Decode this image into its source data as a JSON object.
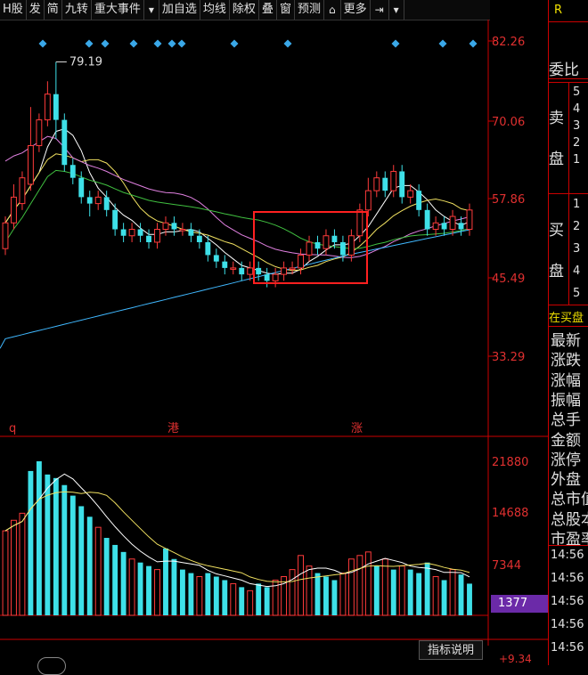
{
  "toolbar": {
    "items": [
      "H股",
      "发",
      "简",
      "九转",
      "重大事件",
      "▾",
      "加自选",
      "均线",
      "除权",
      "叠",
      "窗",
      "预测",
      "⌂",
      "更多",
      "⇥",
      "▾"
    ]
  },
  "price_axis": [
    "82.26",
    "70.06",
    "57.86",
    "45.49",
    "33.29"
  ],
  "volume_axis": [
    "21880",
    "14688",
    "7344"
  ],
  "volume_current": "1377",
  "max_label": "79.19",
  "event_markers": [
    "q",
    "港",
    "涨"
  ],
  "indicator_button": "指标说明",
  "bottom_pct": "+9.34",
  "right_panel": {
    "top_letter": "R",
    "weibi": "委比",
    "sell_label_1": "卖",
    "sell_label_2": "盘",
    "buy_label_1": "买",
    "buy_label_2": "盘",
    "sell_nums": [
      "5",
      "4",
      "3",
      "2",
      "1"
    ],
    "buy_nums": [
      "1",
      "2",
      "3",
      "4",
      "5"
    ],
    "zaimai": "在买盘",
    "fields": [
      "最新",
      "涨跌",
      "涨幅",
      "振幅",
      "总手",
      "金额",
      "涨停",
      "外盘",
      "总市值",
      "总股本",
      "市盈率"
    ],
    "times": [
      "14:56",
      "14:56",
      "14:56",
      "14:56",
      "14:56"
    ]
  },
  "colors": {
    "up": "#ff3b3b",
    "down": "#3ee0e8",
    "ma1": "#ffffff",
    "ma2": "#f0e060",
    "ma3": "#e080e0",
    "ma4": "#40c040",
    "ma5": "#40b8ff",
    "diamond": "#3aa8e8",
    "highlight": "#ff2020"
  },
  "chart_data": {
    "type": "candlestick",
    "ylim": [
      33.29,
      82.26
    ],
    "candles": [
      {
        "o": 50,
        "c": 54,
        "h": 55,
        "l": 49
      },
      {
        "o": 54,
        "c": 58,
        "h": 60,
        "l": 53
      },
      {
        "o": 57,
        "c": 61,
        "h": 62,
        "l": 56
      },
      {
        "o": 60,
        "c": 66,
        "h": 72,
        "l": 59
      },
      {
        "o": 66,
        "c": 70,
        "h": 71,
        "l": 65
      },
      {
        "o": 70,
        "c": 74,
        "h": 76,
        "l": 69
      },
      {
        "o": 74,
        "c": 70,
        "h": 79,
        "l": 67
      },
      {
        "o": 70,
        "c": 63,
        "h": 71,
        "l": 62
      },
      {
        "o": 63,
        "c": 61,
        "h": 64,
        "l": 60
      },
      {
        "o": 61,
        "c": 58,
        "h": 62,
        "l": 57
      },
      {
        "o": 58,
        "c": 57,
        "h": 59,
        "l": 55
      },
      {
        "o": 57,
        "c": 58,
        "h": 59,
        "l": 56
      },
      {
        "o": 58,
        "c": 56,
        "h": 59,
        "l": 55
      },
      {
        "o": 56,
        "c": 53,
        "h": 57,
        "l": 52
      },
      {
        "o": 53,
        "c": 52,
        "h": 54,
        "l": 51
      },
      {
        "o": 52,
        "c": 53,
        "h": 54,
        "l": 51
      },
      {
        "o": 53,
        "c": 52,
        "h": 54,
        "l": 51
      },
      {
        "o": 52,
        "c": 51,
        "h": 53,
        "l": 50
      },
      {
        "o": 51,
        "c": 53,
        "h": 54,
        "l": 50
      },
      {
        "o": 53,
        "c": 54,
        "h": 55,
        "l": 52
      },
      {
        "o": 54,
        "c": 53,
        "h": 55,
        "l": 52
      },
      {
        "o": 53,
        "c": 53,
        "h": 54,
        "l": 52
      },
      {
        "o": 53,
        "c": 52,
        "h": 54,
        "l": 51
      },
      {
        "o": 52,
        "c": 51,
        "h": 53,
        "l": 50
      },
      {
        "o": 51,
        "c": 49,
        "h": 52,
        "l": 48
      },
      {
        "o": 49,
        "c": 48,
        "h": 50,
        "l": 47
      },
      {
        "o": 48,
        "c": 47,
        "h": 49,
        "l": 46
      },
      {
        "o": 47,
        "c": 47,
        "h": 48,
        "l": 46
      },
      {
        "o": 47,
        "c": 46,
        "h": 48,
        "l": 45
      },
      {
        "o": 46,
        "c": 47,
        "h": 48,
        "l": 45
      },
      {
        "o": 47,
        "c": 46,
        "h": 48,
        "l": 45
      },
      {
        "o": 46,
        "c": 45,
        "h": 47,
        "l": 44
      },
      {
        "o": 45,
        "c": 46,
        "h": 47,
        "l": 44
      },
      {
        "o": 46,
        "c": 47,
        "h": 48,
        "l": 45
      },
      {
        "o": 47,
        "c": 47,
        "h": 48,
        "l": 46
      },
      {
        "o": 47,
        "c": 49,
        "h": 50,
        "l": 46
      },
      {
        "o": 49,
        "c": 51,
        "h": 52,
        "l": 48
      },
      {
        "o": 51,
        "c": 50,
        "h": 52,
        "l": 49
      },
      {
        "o": 50,
        "c": 52,
        "h": 53,
        "l": 49
      },
      {
        "o": 52,
        "c": 51,
        "h": 53,
        "l": 50
      },
      {
        "o": 51,
        "c": 49,
        "h": 52,
        "l": 48
      },
      {
        "o": 49,
        "c": 52,
        "h": 53,
        "l": 48
      },
      {
        "o": 52,
        "c": 56,
        "h": 57,
        "l": 51
      },
      {
        "o": 56,
        "c": 59,
        "h": 61,
        "l": 55
      },
      {
        "o": 59,
        "c": 61,
        "h": 62,
        "l": 58
      },
      {
        "o": 61,
        "c": 59,
        "h": 62,
        "l": 58
      },
      {
        "o": 59,
        "c": 62,
        "h": 63,
        "l": 58
      },
      {
        "o": 62,
        "c": 58,
        "h": 63,
        "l": 57
      },
      {
        "o": 58,
        "c": 59,
        "h": 60,
        "l": 57
      },
      {
        "o": 59,
        "c": 56,
        "h": 60,
        "l": 55
      },
      {
        "o": 56,
        "c": 53,
        "h": 57,
        "l": 52
      },
      {
        "o": 53,
        "c": 54,
        "h": 55,
        "l": 52
      },
      {
        "o": 54,
        "c": 53,
        "h": 55,
        "l": 52
      },
      {
        "o": 53,
        "c": 55,
        "h": 56,
        "l": 52
      },
      {
        "o": 54,
        "c": 53,
        "h": 55,
        "l": 52
      },
      {
        "o": 53,
        "c": 56,
        "h": 57,
        "l": 52
      }
    ],
    "volumes": [
      {
        "v": 12000,
        "up": true
      },
      {
        "v": 13500,
        "up": true
      },
      {
        "v": 14500,
        "up": true
      },
      {
        "v": 20500,
        "up": false
      },
      {
        "v": 21880,
        "up": false
      },
      {
        "v": 20000,
        "up": false
      },
      {
        "v": 19500,
        "up": false
      },
      {
        "v": 18500,
        "up": false
      },
      {
        "v": 17000,
        "up": false
      },
      {
        "v": 15500,
        "up": false
      },
      {
        "v": 14000,
        "up": false
      },
      {
        "v": 12500,
        "up": true
      },
      {
        "v": 11000,
        "up": false
      },
      {
        "v": 10000,
        "up": false
      },
      {
        "v": 9000,
        "up": false
      },
      {
        "v": 8000,
        "up": true
      },
      {
        "v": 7500,
        "up": false
      },
      {
        "v": 7000,
        "up": false
      },
      {
        "v": 6500,
        "up": true
      },
      {
        "v": 9500,
        "up": false
      },
      {
        "v": 8000,
        "up": false
      },
      {
        "v": 6500,
        "up": false
      },
      {
        "v": 6000,
        "up": false
      },
      {
        "v": 5500,
        "up": true
      },
      {
        "v": 6000,
        "up": false
      },
      {
        "v": 5500,
        "up": false
      },
      {
        "v": 5000,
        "up": false
      },
      {
        "v": 4500,
        "up": true
      },
      {
        "v": 4000,
        "up": false
      },
      {
        "v": 3500,
        "up": true
      },
      {
        "v": 4500,
        "up": false
      },
      {
        "v": 4000,
        "up": false
      },
      {
        "v": 5000,
        "up": true
      },
      {
        "v": 5500,
        "up": true
      },
      {
        "v": 6500,
        "up": true
      },
      {
        "v": 8500,
        "up": true
      },
      {
        "v": 7000,
        "up": true
      },
      {
        "v": 6000,
        "up": false
      },
      {
        "v": 5500,
        "up": false
      },
      {
        "v": 5000,
        "up": false
      },
      {
        "v": 6000,
        "up": true
      },
      {
        "v": 8000,
        "up": true
      },
      {
        "v": 8500,
        "up": true
      },
      {
        "v": 9000,
        "up": true
      },
      {
        "v": 7000,
        "up": false
      },
      {
        "v": 8000,
        "up": true
      },
      {
        "v": 6500,
        "up": false
      },
      {
        "v": 7000,
        "up": true
      },
      {
        "v": 6500,
        "up": false
      },
      {
        "v": 6000,
        "up": false
      },
      {
        "v": 7500,
        "up": false
      },
      {
        "v": 5500,
        "up": true
      },
      {
        "v": 5000,
        "up": false
      },
      {
        "v": 6500,
        "up": true
      },
      {
        "v": 5800,
        "up": false
      },
      {
        "v": 4500,
        "up": false
      }
    ]
  }
}
